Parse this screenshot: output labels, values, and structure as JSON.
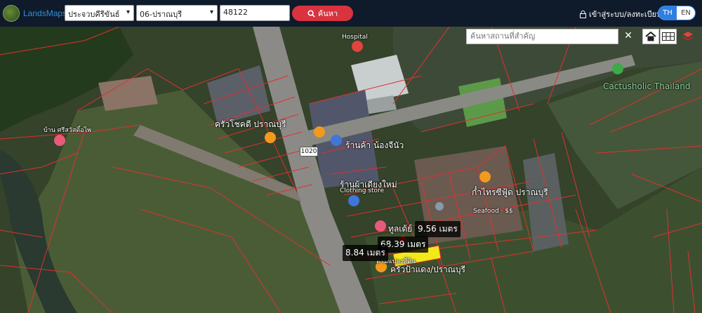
{
  "header": {
    "logo_text": "LandsMaps",
    "province_select": "ประจวบคีรีขันธ์",
    "district_select": "06-ปราณบุรี",
    "postcode_value": "48122",
    "search_button": "ค้นหา",
    "login_text": "เข้าสู่ระบบ/ลงทะเบียน",
    "lang_th": "TH",
    "lang_en": "EN"
  },
  "map": {
    "place_search_placeholder": "ค้นหาสถานที่สำคัญ",
    "clear_symbol": "✕",
    "road_number": "1020",
    "pois": {
      "hospital": "Hospital",
      "cactusholic": "Cactusholic Thailand",
      "house_left": "บ้าน ศรีสวัสดิ์อไพ",
      "restaurant1": "ครัวโชคดี ปราณบุรี",
      "shop1": "ร้านค้า น้องจีนัว",
      "clothing_th": "ร้านผ้าเดียงใหม่",
      "clothing_en": "Clothing store",
      "seafood_th": "ก๋ำไทรซีฟู้ด ปราณบุรี",
      "seafood_en": "Seafood · $$",
      "pink_shop": "ทูลเด้ย์",
      "restaurant2": "ครัวป้าแดง/ปราณบุรี",
      "parcel_label": "ตามแปลงที่ดิน"
    },
    "measurements": {
      "m1": "9.56 เมตร",
      "m2": "68.39 เมตร",
      "m3": "8.84 เมตร"
    }
  },
  "colors": {
    "topbar": "#0f1a2b",
    "accent_red": "#d9333f",
    "lang_blue": "#2f7fe0",
    "parcel_line": "#e03030",
    "parcel_highlight": "#f3e81a"
  }
}
